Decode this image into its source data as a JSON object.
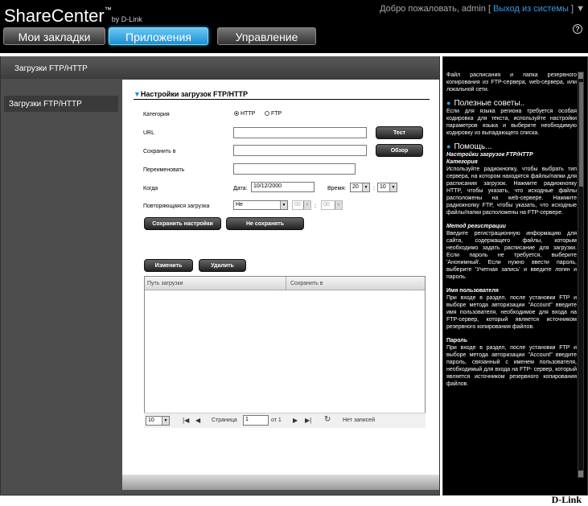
{
  "header": {
    "logo": "ShareCenter",
    "logo_tm": "™",
    "logo_by": "by D-Link",
    "welcome_prefix": "Добро пожаловать, admin [ ",
    "logout": "Выход из системы",
    "welcome_suffix": " ] ▼",
    "help": "?"
  },
  "tabs": [
    "Мои закладки",
    "Приложения",
    "Управление"
  ],
  "panel": {
    "title": "Загрузки FTP/HTTP"
  },
  "sidebar": {
    "items": [
      {
        "label": "Загрузки FTP/HTTP"
      }
    ]
  },
  "form": {
    "section_title": "Настройки загрузок FTP/HTTP",
    "category_label": "Категория",
    "http_label": "HTTP",
    "ftp_label": "FTP",
    "url_label": "URL",
    "url_value": "",
    "test_button": "Тест",
    "save_to_label": "Сохранить в",
    "save_to_value": "",
    "browse_button": "Обзор",
    "rename_label": "Переименовать",
    "rename_value": "",
    "when_label": "Когда",
    "date_label": "Дата:",
    "date_value": "10/12/2000",
    "time_label": "Время:",
    "hour_value": "20",
    "minute_value": "10",
    "time_sep": ":",
    "repeat_label": "Повторяющаяся загрузка",
    "repeat_value": "Не",
    "repeat_h": "00",
    "repeat_m": "00",
    "save_button": "Сохранить настройки",
    "dont_save_button": "Не сохранять"
  },
  "list": {
    "edit_button": "Изменить",
    "delete_button": "Удалить",
    "columns": [
      "Путь загрузки",
      "Сохранить в"
    ],
    "page_size": "10",
    "page_label": "Страница",
    "page_value": "1",
    "of_label": "от 1",
    "empty_text": "Нет записей"
  },
  "help_panel": {
    "intro": "Файл расписания и папка резервного копирования из FTP-сервера, web-сервера, или локальной сети.",
    "tips_title": "Полезные советы..",
    "tips_text": "Если для языка региона требуется особая кодировка для текста, используйте настройки параметров языка и выберите необходимую кодировку из выпадающего списка.",
    "help_title": "Помощь...",
    "help_subtitle": "Настройки загрузок FTP/HTTP",
    "category_title": "Категория",
    "category_text": "Используйте радиокнопку, чтобы выбрать тип сервера, на котором находятся файлы/папки для расписания загрузок. Нажмите радиокнопку HTTP, чтобы указать, что исходные файлы расположены на web-сервере. Нажмите радиокнопку FTP, чтобы указать, что исходные файлы/папки расположены на FTP-сервере.",
    "login_title": "Метод регистрации",
    "login_text": "Введите регистрационную информацию для сайта, содержащего файлы, которым необходимо задать расписание для загрузки. Если пароль не требуется, выберите 'Анонимный'. Если нужно ввести пароль, выберите 'Учетная запись' и введите логин и пароль.",
    "user_title": "Имя пользователя",
    "user_text": "При входе в раздел, после установки FTP и выборе метода авторизации \"Account\" введите имя пользователя, необходимое для входа на FTP-сервер, который является источником резервного копирования файлов.",
    "pass_title": "Пароль",
    "pass_text": "При входе в раздел, после установки FTP и выборе метода авторизации \"Account\" введите пароль, связанный с именем пользователя, необходимый для входа на FTP- сервер, который является источником резервного копирования файлов."
  },
  "footer": {
    "brand": "D-Link"
  }
}
